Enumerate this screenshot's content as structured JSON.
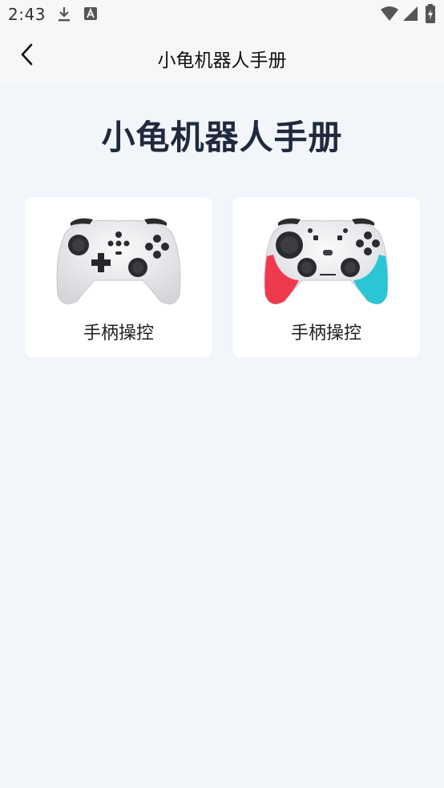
{
  "status_bar": {
    "time": "2:43",
    "icons": [
      "download-icon",
      "font-app-icon",
      "wifi-icon",
      "signal-icon",
      "battery-charging-icon"
    ]
  },
  "app_bar": {
    "back_icon": "chevron-left-icon",
    "title": "小龟机器人手册"
  },
  "main": {
    "heading": "小龟机器人手册",
    "cards": [
      {
        "label": "手柄操控",
        "image": "white-gamepad",
        "accent": "#ffffff"
      },
      {
        "label": "手柄操控",
        "image": "red-cyan-gamepad",
        "accent_left": "#ef3a4d",
        "accent_right": "#2bc6d6"
      }
    ]
  },
  "colors": {
    "background": "#f2f5fa",
    "bar_background": "#f6f7f9",
    "heading": "#1f2a3c",
    "card": "#ffffff"
  }
}
